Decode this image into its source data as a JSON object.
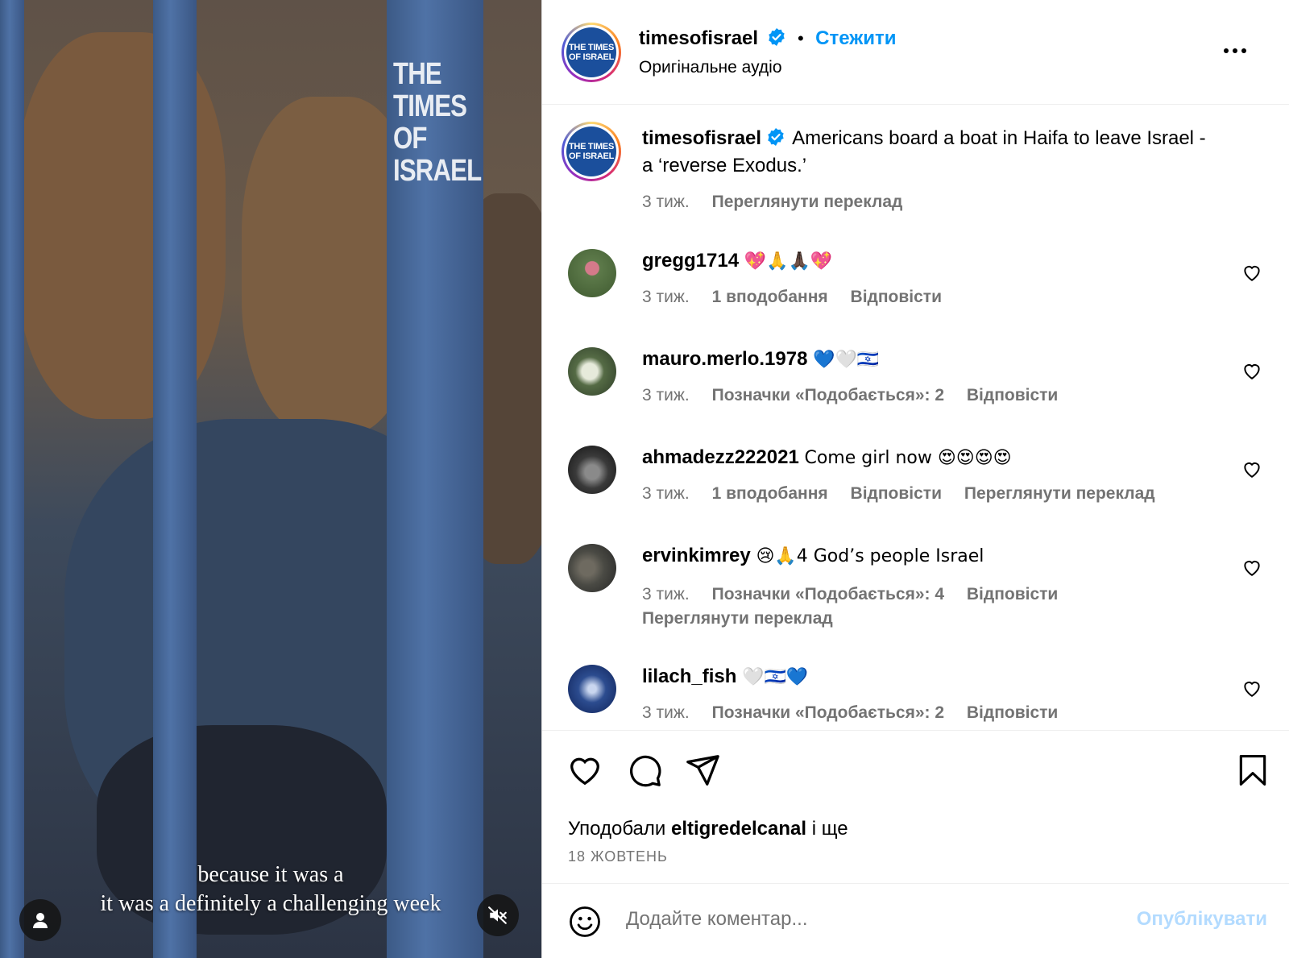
{
  "video": {
    "watermark_line1": "THE TIMES",
    "watermark_line2": "OF ISRAEL",
    "subtitle_line1": "because it was a",
    "subtitle_line2": "it was a definitely a challenging week"
  },
  "header": {
    "username": "timesofisrael",
    "follow_label": "Стежити",
    "audio_label": "Оригінальне аудіо",
    "logo_text_line1": "THE TIMES",
    "logo_text_line2": "OF ISRAEL"
  },
  "caption": {
    "username": "timesofisrael",
    "text": "Americans board a boat in Haifa to leave Israel - a ‘reverse Exodus.’",
    "time": "3 тиж.",
    "translate_label": "Переглянути переклад"
  },
  "comments": [
    {
      "username": "gregg1714",
      "text": "💖🙏🙏🏿💖",
      "time": "3 тиж.",
      "likes": "1 вподобання",
      "reply": "Відповісти",
      "translate": ""
    },
    {
      "username": "mauro.merlo.1978",
      "text": "💙🤍🇮🇱",
      "time": "3 тиж.",
      "likes": "Позначки «Подобається»: 2",
      "reply": "Відповісти",
      "translate": ""
    },
    {
      "username": "ahmadezz222021",
      "text": "Come girl now 😍😍😍😍",
      "time": "3 тиж.",
      "likes": "1 вподобання",
      "reply": "Відповісти",
      "translate": "Переглянути переклад"
    },
    {
      "username": "ervinkimrey",
      "text": "😢🙏4 God’s people Israel",
      "time": "3 тиж.",
      "likes": "Позначки «Подобається»: 4",
      "reply": "Відповісти",
      "translate": "Переглянути переклад"
    },
    {
      "username": "lilach_fish",
      "text": "🤍🇮🇱💙",
      "time": "3 тиж.",
      "likes": "Позначки «Подобається»: 2",
      "reply": "Відповісти",
      "translate": ""
    }
  ],
  "likes": {
    "prefix": "Уподобали",
    "user": "eltigredelcanal",
    "suffix": "і ще",
    "date": "18 ЖОВТЕНЬ"
  },
  "composer": {
    "placeholder": "Додайте коментар...",
    "post_label": "Опублікувати"
  },
  "colors": {
    "accent": "#0095f6",
    "muted": "#737373",
    "verified": "#0095f6",
    "post_disabled": "#b3dbff"
  }
}
